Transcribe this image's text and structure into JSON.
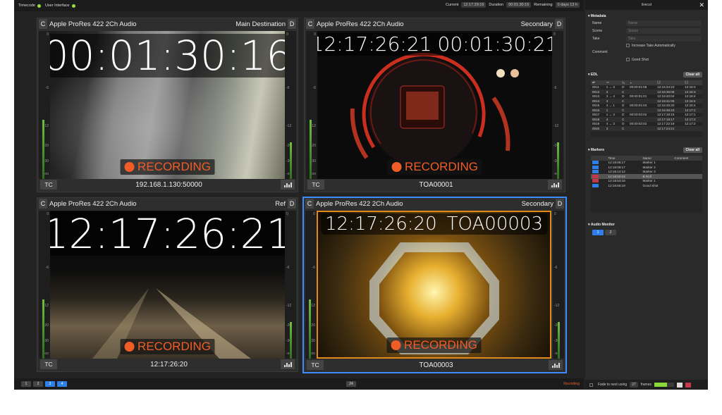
{
  "topbar": {
    "timecode_label": "Timecode",
    "ui_label": "User Interface",
    "current_label": "Current",
    "current": "12:17:29:16",
    "duration_label": "Duration",
    "duration": "00:01:30:16",
    "remaining_label": "Remaining",
    "remaining": "0 days 13 h"
  },
  "panels": [
    {
      "title": "Apple ProRes 422 2Ch Audio",
      "dest": "Main Destination",
      "c": "C",
      "d": "D",
      "tc_btn": "TC",
      "footer": "192.168.1.130:50000",
      "overlay": [
        "00:01:30:16"
      ],
      "rec": "RECORDING"
    },
    {
      "title": "Apple ProRes 422 2Ch Audio",
      "dest": "Secondary",
      "c": "C",
      "d": "D",
      "tc_btn": "TC",
      "footer": "TOA00001",
      "overlay": [
        "12:17:26:21",
        "00:01:30:21"
      ],
      "rec": "RECORDING"
    },
    {
      "title": "Apple ProRes 422 2Ch Audio",
      "dest": "Ref",
      "c": "C",
      "d": "D",
      "tc_btn": "TC",
      "footer": "12:17:26:20",
      "overlay": [
        "12:17:26:21"
      ],
      "rec": "RECORDING"
    },
    {
      "title": "Apple ProRes 422 2Ch Audio",
      "dest": "Secondary",
      "c": "C",
      "d": "D",
      "tc_btn": "TC",
      "footer": "TOA00003",
      "overlay": [
        "12:17:26:20",
        "TOA00003"
      ],
      "rec": "RECORDING"
    }
  ],
  "meter_labels": [
    "0",
    "-6",
    "-12",
    "-20",
    "-30",
    "-oo"
  ],
  "bottom": {
    "buttons": [
      "1",
      "2",
      "3",
      "4"
    ],
    "center": "24",
    "status": "Recording"
  },
  "sidebar": {
    "title": "livecut",
    "metadata": {
      "title": "Metadata",
      "name_label": "Name",
      "name_ph": "Name",
      "scene_label": "Scene",
      "scene_ph": "Scene",
      "take_label": "Take",
      "take_ph": "Take",
      "increase": "Increase Take Automatically",
      "comment_label": "Comment",
      "good_shot": "Good Shot"
    },
    "edl": {
      "title": "EDL",
      "clear": "Clear all",
      "headers": [
        "#",
        "",
        "",
        "",
        "",
        "",
        ""
      ],
      "rows": [
        [
          "0011",
          "1 → 3",
          "D",
          "00:00:01:08",
          "12:16:34:23",
          "12:16:3"
        ],
        [
          "0012",
          "3",
          "C",
          "",
          "12:16:36:06",
          "12:16:3"
        ],
        [
          "0013",
          "3 → 4",
          "D",
          "00:00:01:01",
          "12:16:40:04",
          "12:16:4"
        ],
        [
          "0014",
          "4",
          "C",
          "",
          "12:16:41:05",
          "12:16:4"
        ],
        [
          "0015",
          "4 → 1",
          "D",
          "00:00:01:03",
          "12:16:45:20",
          "12:16:4"
        ],
        [
          "0016",
          "1",
          "C",
          "",
          "12:16:46:23",
          "12:17:1"
        ],
        [
          "0017",
          "1 → 4",
          "D",
          "00:00:02:02",
          "12:17:18:15",
          "12:17:1"
        ],
        [
          "0018",
          "4",
          "C",
          "",
          "12:17:18:17",
          "12:17:2"
        ],
        [
          "0019",
          "4 → 3",
          "D",
          "00:00:02:02",
          "12:17:22:19",
          "12:17:2"
        ],
        [
          "0020",
          "3",
          "C",
          "",
          "12:17:24:21",
          ""
        ]
      ]
    },
    "markers": {
      "title": "Markers",
      "clear": "Clear all",
      "headers": [
        "",
        "Time",
        "Name",
        "Comment"
      ],
      "rows": [
        [
          "12:16:06:17",
          "Marker 1"
        ],
        [
          "12:16:09:17",
          "Marker 2"
        ],
        [
          "12:16:14:12",
          "Marker 3"
        ],
        [
          "12:16:50:24",
          "B Roll"
        ],
        [
          "12:16:53:16",
          "Marker 1"
        ],
        [
          "12:16:55:19",
          "Good Shot"
        ]
      ]
    },
    "audio": {
      "title": "Audio Monitor",
      "buttons": [
        "1",
        "2"
      ]
    },
    "footer": {
      "fade": "Fade to next using",
      "frames_val": "27",
      "frames": "frames"
    }
  }
}
